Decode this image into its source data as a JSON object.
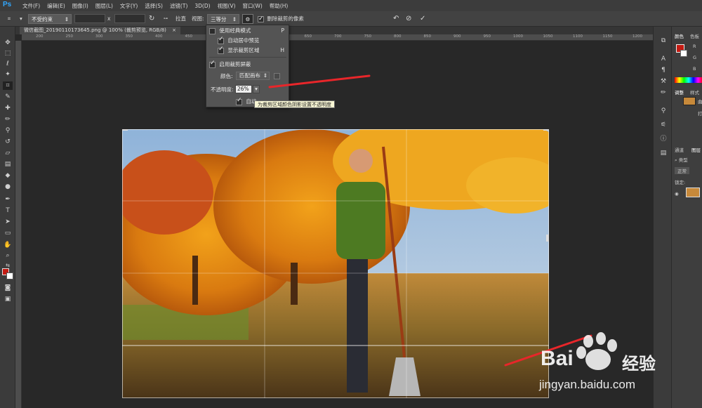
{
  "app": {
    "logo": "Ps"
  },
  "menu": [
    "文件(F)",
    "编辑(E)",
    "图像(I)",
    "图层(L)",
    "文字(Y)",
    "选择(S)",
    "滤镜(T)",
    "3D(D)",
    "视图(V)",
    "窗口(W)",
    "帮助(H)"
  ],
  "options_bar": {
    "ratio_select": "不受约束",
    "x_label": "x",
    "straighten_label": "拉直",
    "view_label": "视图:",
    "view_select": "三等分",
    "delete_pixels_label": "删除裁剪的像素",
    "delete_pixels_checked": true
  },
  "document_tab": {
    "title": "微信截图_20190110173645.png @ 100% (裁剪预览, RGB/8)",
    "close": "×"
  },
  "ruler_ticks": [
    "200",
    "250",
    "300",
    "350",
    "400",
    "450",
    "500",
    "550",
    "600",
    "650",
    "700",
    "750",
    "800",
    "850",
    "900",
    "950",
    "1000",
    "1050",
    "1100",
    "1150",
    "1200"
  ],
  "crop_settings": {
    "classic_mode_label": "使用经典模式",
    "classic_mode_shortcut": "P",
    "classic_mode_checked": false,
    "auto_center_label": "自动居中预览",
    "auto_center_checked": true,
    "show_cropped_label": "显示裁剪区域",
    "show_cropped_shortcut": "H",
    "show_cropped_checked": true,
    "enable_shield_label": "启用裁剪屏蔽",
    "enable_shield_checked": true,
    "color_label": "颜色:",
    "color_select": "匹配画布",
    "opacity_label": "不透明度:",
    "opacity_value": "26%",
    "auto_adjust_label": "自动",
    "auto_adjust_checked": true,
    "tooltip": "为裁剪区域颜色阴影设置不透明度"
  },
  "right_panels": {
    "color_tab": "颜色",
    "swatches_tab": "色板",
    "adjust_tab": "调整",
    "styles_tab": "样式",
    "channels_tab": "通道",
    "layers_tab": "图层",
    "kind_label": "类型",
    "blend_mode": "正常",
    "lock_label": "锁定:",
    "side_label_1": "R",
    "side_label_2": "G",
    "side_label_3": "B",
    "adj_char": "曲",
    "layer_char": "打"
  },
  "watermark": {
    "brand": "Bai",
    "brand2": "经验",
    "url": "jingyan.baidu.com"
  },
  "colors": {
    "foreground": "#c41a12",
    "background": "#ffffff",
    "annotation_arrow": "#e8262a",
    "accent": "#31a8ff"
  }
}
